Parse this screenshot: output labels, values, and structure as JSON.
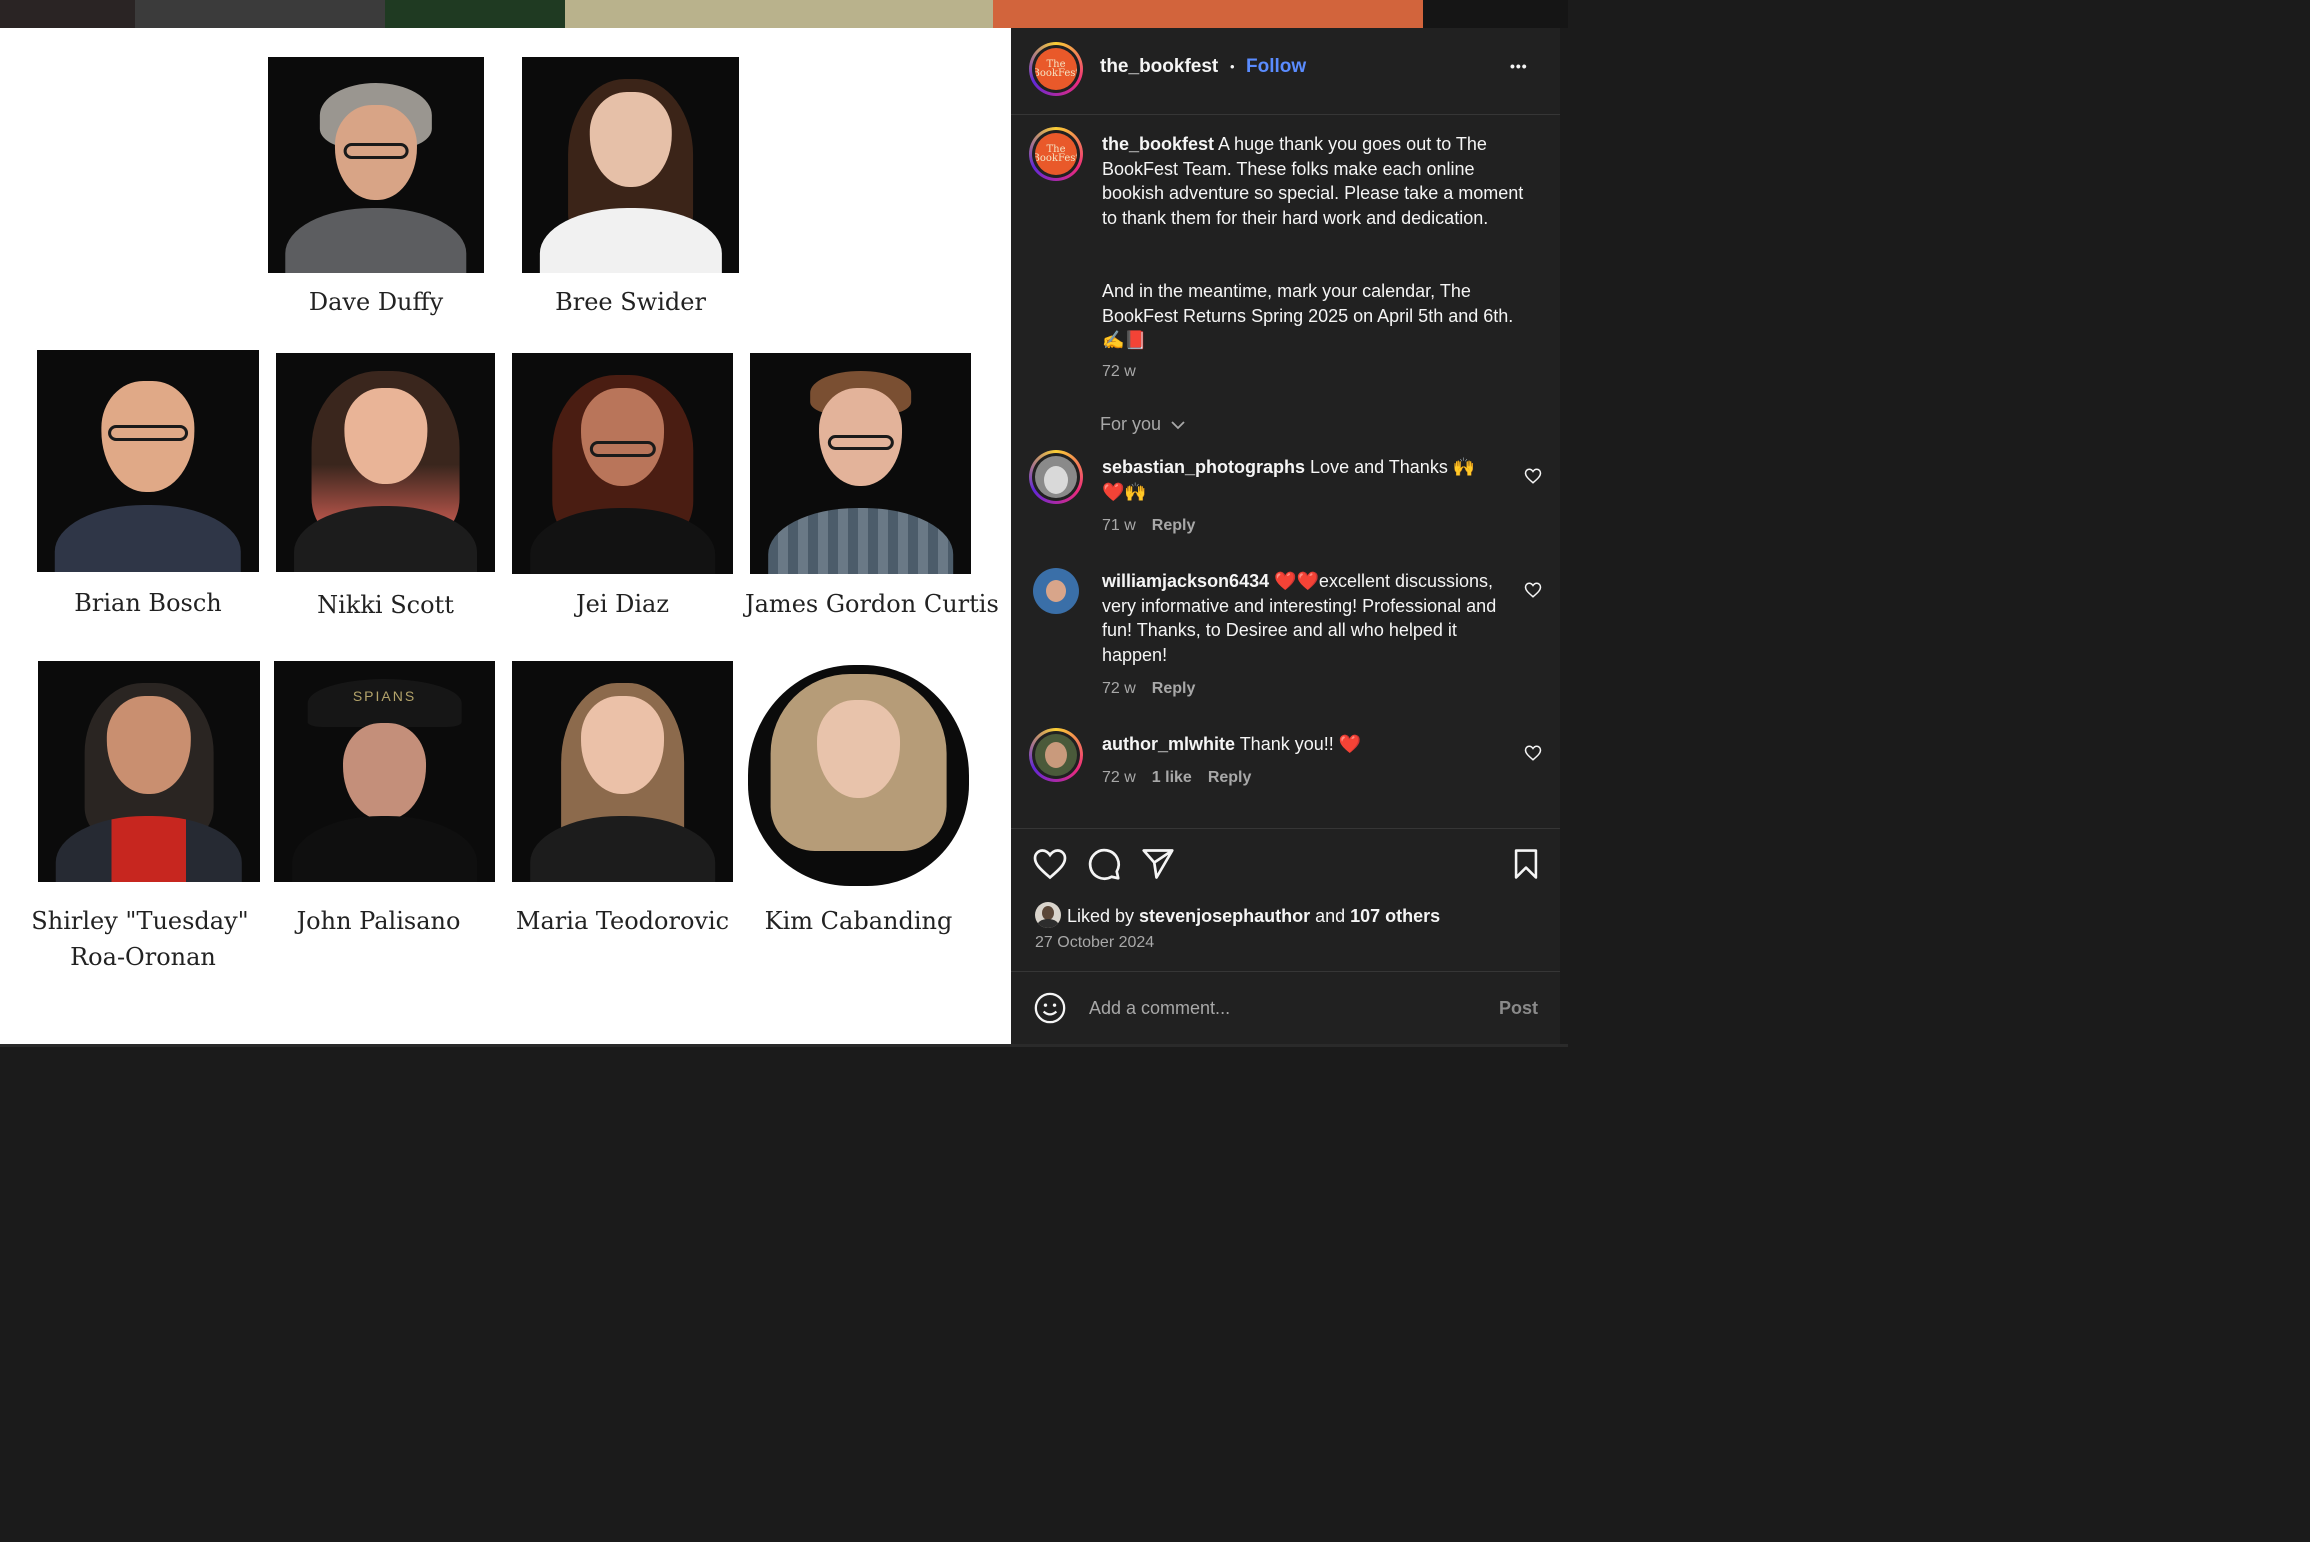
{
  "post": {
    "captions": {
      "dave": "Dave Duffy",
      "bree": "Bree Swider",
      "brian": "Brian Bosch",
      "nikki": "Nikki Scott",
      "jei": "Jei Diaz",
      "james": "James Gordon Curtis",
      "shirley_line1": "Shirley \"Tuesday\"",
      "shirley_line2": "Roa-Oronan",
      "john": "John Palisano",
      "maria": "Maria Teodorovic",
      "kim": "Kim Cabanding"
    },
    "hat_text": "SPIANS"
  },
  "header": {
    "username": "the_bookfest",
    "separator": "•",
    "follow_label": "Follow",
    "more_label": "•••",
    "logo_text_top": "The",
    "logo_text_bottom": "BookFest"
  },
  "caption": {
    "username": "the_bookfest",
    "para1": " A huge thank you goes out to The BookFest Team. These folks make each online bookish adventure so special. Please take a moment to thank them for their hard work and dedication.",
    "para2": "And in the meantime, mark your calendar, The BookFest Returns Spring 2025 on April 5th and 6th. ✍️📕",
    "time": "72 w"
  },
  "for_you": {
    "label": "For you"
  },
  "comments": [
    {
      "username": "sebastian_photographs",
      "text": " Love and Thanks 🙌 ❤️🙌",
      "time": "71 w",
      "likes": "",
      "reply": "Reply"
    },
    {
      "username": "williamjackson6434",
      "text": " ❤️❤️excellent discussions, very informative and interesting! Professional and fun! Thanks, to Desiree and all who helped it happen!",
      "time": "72 w",
      "likes": "",
      "reply": "Reply"
    },
    {
      "username": "author_mlwhite",
      "text": " Thank you!! ❤️",
      "time": "72 w",
      "likes": "1 like",
      "reply": "Reply"
    }
  ],
  "actions": {
    "liked_by_prefix": "Liked by ",
    "liked_by_user": "stevenjosephauthor",
    "liked_by_and": " and ",
    "liked_by_others": "107 others",
    "date": "27 October 2024"
  },
  "composer": {
    "placeholder": "Add a comment...",
    "post_label": "Post"
  },
  "colors": {
    "accent_blue": "#5a8cff",
    "panel_bg": "#212121",
    "muted_text": "#a8a8a8"
  }
}
